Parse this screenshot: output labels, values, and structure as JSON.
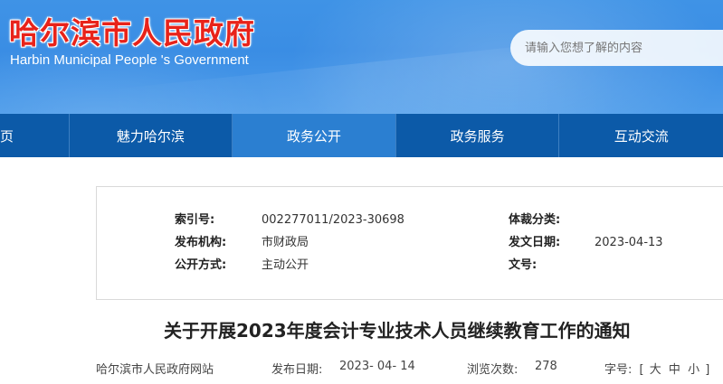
{
  "header": {
    "site_title": "哈尔滨市人民政府",
    "site_subtitle": "Harbin Municipal People 's Government",
    "search_placeholder": "请输入您想了解的内容"
  },
  "nav": {
    "items": [
      {
        "label": "页"
      },
      {
        "label": "魅力哈尔滨"
      },
      {
        "label": "政务公开",
        "active": true
      },
      {
        "label": "政务服务"
      },
      {
        "label": "互动交流"
      }
    ]
  },
  "info": {
    "index_label": "索引号:",
    "index_value": "002277011/2023-30698",
    "category_label": "体裁分类:",
    "category_value": "",
    "publisher_label": "发布机构:",
    "publisher_value": "市财政局",
    "doc_date_label": "发文日期:",
    "doc_date_value": "2023-04-13",
    "open_mode_label": "公开方式:",
    "open_mode_value": "主动公开",
    "doc_no_label": "文号:",
    "doc_no_value": ""
  },
  "article": {
    "title": "关于开展2023年度会计专业技术人员继续教育工作的通知"
  },
  "meta": {
    "source": "哈尔滨市人民政府网站",
    "publish_date_label": "发布日期:",
    "publish_date_value": "2023- 04- 14",
    "views_label": "浏览次数:",
    "views_value": "278",
    "font_label": "字号:",
    "font_open": "[",
    "font_large": "大",
    "font_medium": "中",
    "font_small": "小",
    "font_close": "]"
  },
  "colors": {
    "title_red": "#e8231a",
    "nav_blue": "#0c5aa8",
    "nav_active": "#2b7fd1"
  }
}
